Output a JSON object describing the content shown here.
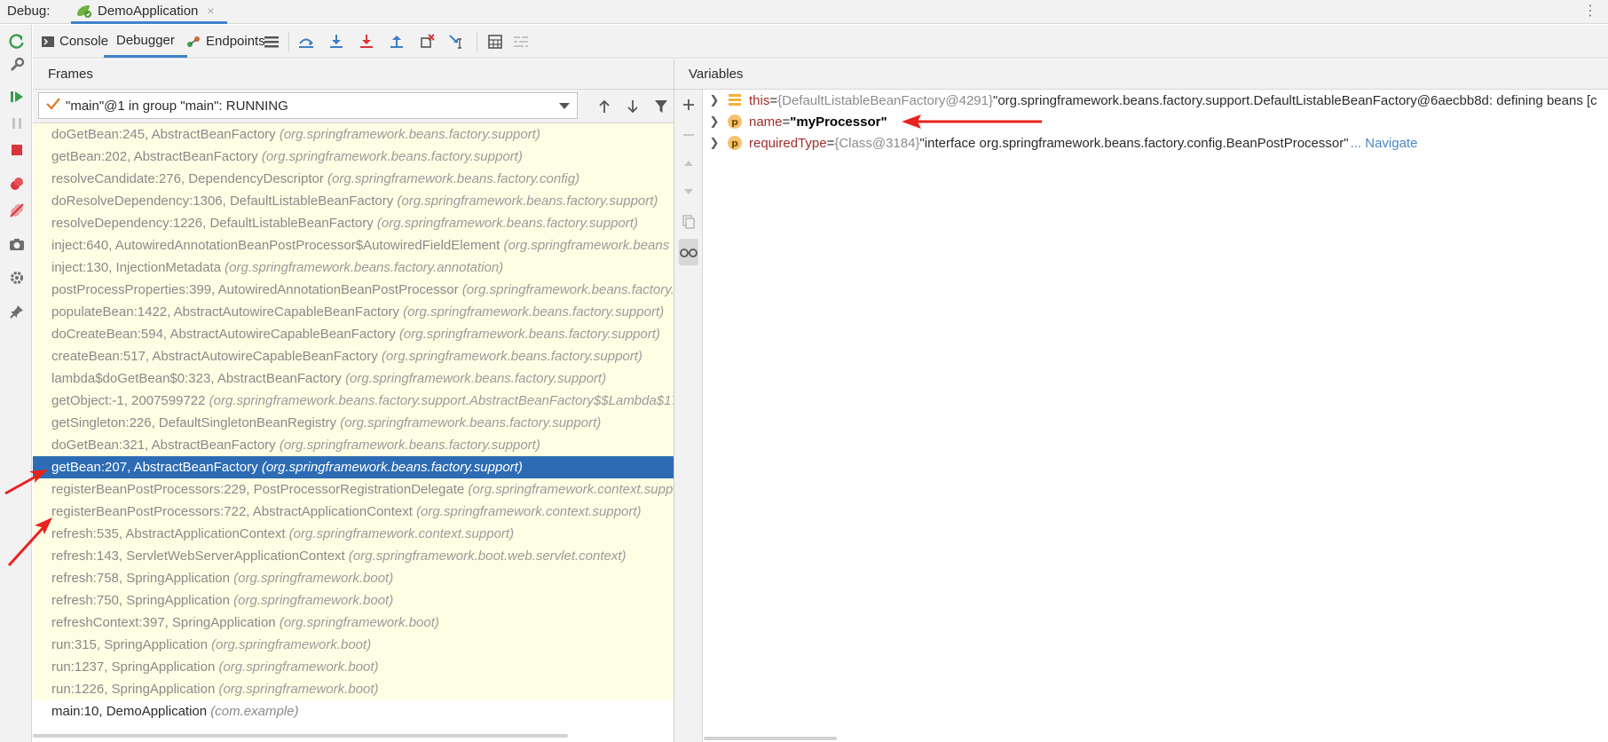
{
  "topbar": {
    "debug_label": "Debug:",
    "run_tab_label": "DemoApplication",
    "run_tab_close": "×"
  },
  "toolbar": {
    "tabs": [
      {
        "label": "Console",
        "icon": "console-icon"
      },
      {
        "label": "Debugger",
        "icon": "",
        "active": true
      },
      {
        "label": "Endpoints",
        "icon": "endpoints-icon"
      }
    ],
    "buttons": [
      "show-execution-point-icon",
      "step-over-icon",
      "step-into-icon",
      "force-step-into-icon",
      "step-out-icon",
      "drop-frame-icon",
      "run-to-cursor-icon",
      "evaluate-expression-icon",
      "trace-icon"
    ]
  },
  "frames": {
    "header": "Frames",
    "thread": "\"main\"@1 in group \"main\": RUNNING",
    "items": [
      {
        "method": "doGetBean:245, AbstractBeanFactory",
        "pkg": "(org.springframework.beans.factory.support)"
      },
      {
        "method": "getBean:202, AbstractBeanFactory",
        "pkg": "(org.springframework.beans.factory.support)"
      },
      {
        "method": "resolveCandidate:276, DependencyDescriptor",
        "pkg": "(org.springframework.beans.factory.config)"
      },
      {
        "method": "doResolveDependency:1306, DefaultListableBeanFactory",
        "pkg": "(org.springframework.beans.factory.support)"
      },
      {
        "method": "resolveDependency:1226, DefaultListableBeanFactory",
        "pkg": "(org.springframework.beans.factory.support)"
      },
      {
        "method": "inject:640, AutowiredAnnotationBeanPostProcessor$AutowiredFieldElement",
        "pkg": "(org.springframework.beans"
      },
      {
        "method": "inject:130, InjectionMetadata",
        "pkg": "(org.springframework.beans.factory.annotation)"
      },
      {
        "method": "postProcessProperties:399, AutowiredAnnotationBeanPostProcessor",
        "pkg": "(org.springframework.beans.factory."
      },
      {
        "method": "populateBean:1422, AbstractAutowireCapableBeanFactory",
        "pkg": "(org.springframework.beans.factory.support)"
      },
      {
        "method": "doCreateBean:594, AbstractAutowireCapableBeanFactory",
        "pkg": "(org.springframework.beans.factory.support)"
      },
      {
        "method": "createBean:517, AbstractAutowireCapableBeanFactory",
        "pkg": "(org.springframework.beans.factory.support)"
      },
      {
        "method": "lambda$doGetBean$0:323, AbstractBeanFactory",
        "pkg": "(org.springframework.beans.factory.support)"
      },
      {
        "method": "getObject:-1, 2007599722",
        "pkg": "(org.springframework.beans.factory.support.AbstractBeanFactory$$Lambda$17"
      },
      {
        "method": "getSingleton:226, DefaultSingletonBeanRegistry",
        "pkg": "(org.springframework.beans.factory.support)"
      },
      {
        "method": "doGetBean:321, AbstractBeanFactory",
        "pkg": "(org.springframework.beans.factory.support)"
      },
      {
        "method": "getBean:207, AbstractBeanFactory",
        "pkg": "(org.springframework.beans.factory.support)",
        "selected": true
      },
      {
        "method": "registerBeanPostProcessors:229, PostProcessorRegistrationDelegate",
        "pkg": "(org.springframework.context.suppo"
      },
      {
        "method": "registerBeanPostProcessors:722, AbstractApplicationContext",
        "pkg": "(org.springframework.context.support)"
      },
      {
        "method": "refresh:535, AbstractApplicationContext",
        "pkg": "(org.springframework.context.support)"
      },
      {
        "method": "refresh:143, ServletWebServerApplicationContext",
        "pkg": "(org.springframework.boot.web.servlet.context)"
      },
      {
        "method": "refresh:758, SpringApplication",
        "pkg": "(org.springframework.boot)"
      },
      {
        "method": "refresh:750, SpringApplication",
        "pkg": "(org.springframework.boot)"
      },
      {
        "method": "refreshContext:397, SpringApplication",
        "pkg": "(org.springframework.boot)"
      },
      {
        "method": "run:315, SpringApplication",
        "pkg": "(org.springframework.boot)"
      },
      {
        "method": "run:1237, SpringApplication",
        "pkg": "(org.springframework.boot)"
      },
      {
        "method": "run:1226, SpringApplication",
        "pkg": "(org.springframework.boot)"
      },
      {
        "method": "main:10, DemoApplication",
        "pkg": "(com.example)",
        "plain": true
      }
    ]
  },
  "variables": {
    "header": "Variables",
    "items": [
      {
        "name": "this",
        "eq": " = ",
        "type": "{DefaultListableBeanFactory@4291}",
        "value": " \"org.springframework.beans.factory.support.DefaultListableBeanFactory@6aecbb8d: defining beans [c",
        "icon": "field-list-icon",
        "bold": false,
        "navigate": ""
      },
      {
        "name": "name",
        "eq": " = ",
        "type": "",
        "value": "\"myProcessor\"",
        "icon": "parameter-icon",
        "bold": true,
        "navigate": ""
      },
      {
        "name": "requiredType",
        "eq": " = ",
        "type": "{Class@3184}",
        "value": " \"interface org.springframework.beans.factory.config.BeanPostProcessor\"",
        "icon": "parameter-icon",
        "bold": false,
        "navigate": "... Navigate"
      }
    ],
    "param_badge": "p"
  },
  "colors": {
    "accent": "#4083c9",
    "selected_row": "#2d6cb5",
    "frame_bg": "#fefee4",
    "annotation": "#e8231e"
  }
}
